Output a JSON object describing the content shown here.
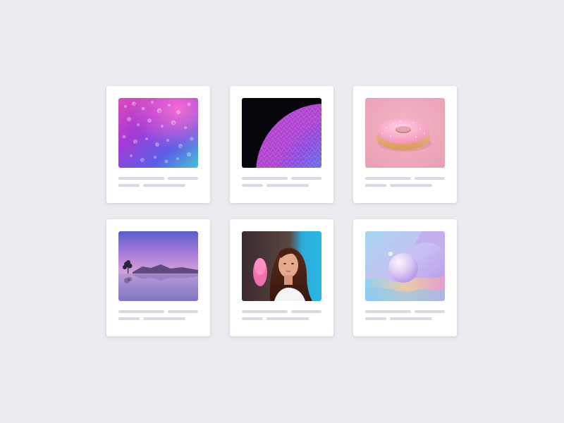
{
  "gallery": {
    "cards": [
      {
        "image": "water-drops-image",
        "accent": "#c14fd6"
      },
      {
        "image": "geodesic-sphere-image",
        "accent": "#6a4fe0"
      },
      {
        "image": "pink-donut-image",
        "accent": "#f2a6c0"
      },
      {
        "image": "lake-landscape-image",
        "accent": "#8a7fd1"
      },
      {
        "image": "woman-portrait-image",
        "accent": "#3cc0e0"
      },
      {
        "image": "abstract-sphere-image",
        "accent": "#b39ef2"
      }
    ]
  },
  "colors": {
    "background": "#ebecf0",
    "card": "#ffffff",
    "placeholder_bar": "#d6d9e6"
  }
}
